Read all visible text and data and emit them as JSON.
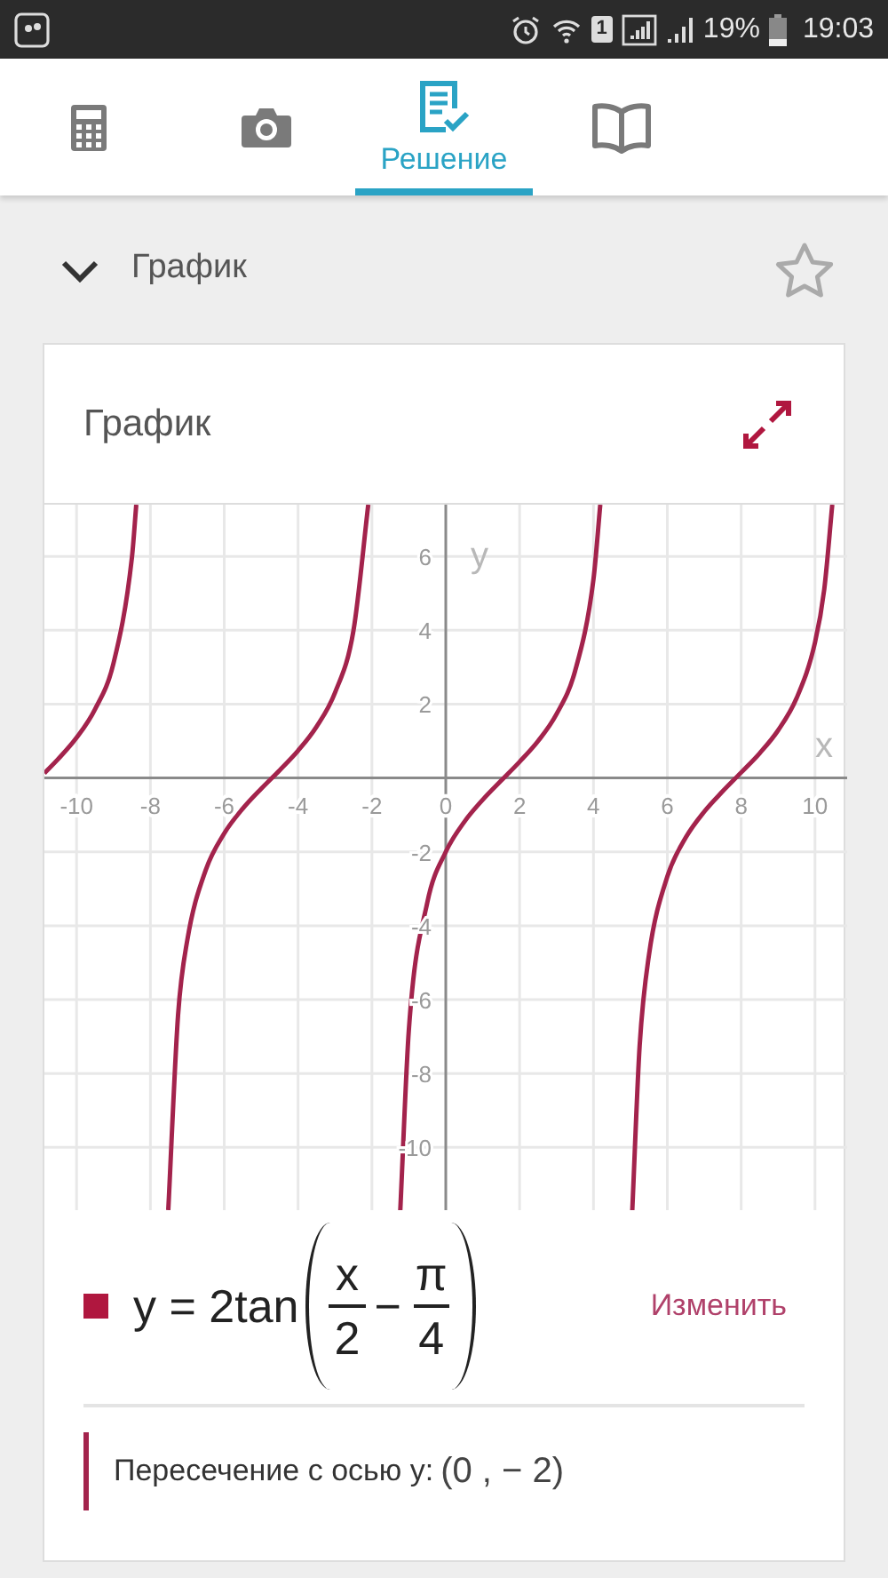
{
  "status_bar": {
    "sim_slot": "1",
    "battery_text": "19%",
    "time": "19:03"
  },
  "tabs": [
    {
      "kind": "calculator",
      "selected": false
    },
    {
      "kind": "camera",
      "selected": false
    },
    {
      "kind": "solution",
      "label": "Решение",
      "selected": true
    },
    {
      "kind": "book",
      "selected": false
    }
  ],
  "section": {
    "title": "График",
    "expanded": true,
    "starred": false
  },
  "card": {
    "title": "График",
    "chart_data": {
      "type": "line",
      "xlabel": "x",
      "ylabel": "y",
      "xlim": [
        -10.87,
        10.87
      ],
      "ylim": [
        -11.7,
        7.4
      ],
      "xticks": [
        -10,
        -8,
        -6,
        -4,
        -2,
        0,
        2,
        4,
        6,
        8,
        10
      ],
      "grid": true,
      "yticks": [
        6,
        4,
        2,
        -2,
        -4,
        -6,
        -8,
        -10
      ],
      "x": [
        -10.87,
        -10.5,
        -10,
        -9.5,
        -9,
        -8.5,
        -8.382,
        -7.515,
        -7.25,
        -7,
        -6.5,
        -6,
        -5.5,
        -5,
        -4.5,
        -4,
        -3.5,
        -3,
        -2.5,
        -2.099,
        -1.232,
        -1,
        -0.5,
        0,
        0.5,
        1,
        1.5,
        2,
        2.5,
        3,
        3.5,
        4,
        4.184,
        5.051,
        5.25,
        5.5,
        6,
        6.5,
        7,
        7.5,
        8,
        8.5,
        9,
        9.5,
        10,
        10.25,
        10.467
      ],
      "series": [
        {
          "color": "#a3234c",
          "values": [
            0.13,
            0.51,
            1.09,
            1.86,
            3.1,
            5.97,
            7.4,
            null,
            null,
            null,
            null,
            null,
            null,
            null,
            null,
            null,
            null,
            null,
            null,
            null,
            null,
            null,
            null,
            null,
            null,
            null,
            null,
            null,
            null,
            null,
            null,
            null,
            null,
            null,
            null,
            null,
            null,
            null,
            null,
            null,
            null,
            null,
            null,
            null,
            null,
            null,
            null
          ]
        },
        {
          "color": "#a3234c",
          "values": [
            null,
            null,
            null,
            null,
            null,
            null,
            null,
            -11.7,
            -6.42,
            -4.39,
            -2.49,
            -1.5,
            -0.83,
            -0.29,
            0.21,
            0.74,
            1.39,
            2.31,
            3.99,
            7.4,
            null,
            null,
            null,
            null,
            null,
            null,
            null,
            null,
            null,
            null,
            null,
            null,
            null,
            null,
            null,
            null,
            null,
            null,
            null,
            null,
            null,
            null,
            null,
            null,
            null,
            null,
            null
          ]
        },
        {
          "color": "#a3234c",
          "values": [
            null,
            null,
            null,
            null,
            null,
            null,
            null,
            null,
            null,
            null,
            null,
            null,
            null,
            null,
            null,
            null,
            null,
            null,
            null,
            null,
            -11.7,
            -6.82,
            -3.37,
            -2,
            -1.19,
            -0.59,
            -0.07,
            0.44,
            1.0,
            1.73,
            2.89,
            5.38,
            7.4,
            null,
            null,
            null,
            null,
            null,
            null,
            null,
            null,
            null,
            null,
            null,
            null,
            null,
            null
          ]
        },
        {
          "color": "#a3234c",
          "values": [
            null,
            null,
            null,
            null,
            null,
            null,
            null,
            null,
            null,
            null,
            null,
            null,
            null,
            null,
            null,
            null,
            null,
            null,
            null,
            null,
            null,
            null,
            null,
            null,
            null,
            null,
            null,
            null,
            null,
            null,
            null,
            null,
            null,
            -11.7,
            -7.26,
            -4.81,
            -2.67,
            -1.61,
            -0.91,
            -0.36,
            0.15,
            0.67,
            1.29,
            2.16,
            3.67,
            5.11,
            7.4
          ]
        }
      ]
    },
    "formula": {
      "color": "#b0173f",
      "prefix": "y = 2tan",
      "numerator_1": "x",
      "denominator_1": "2",
      "operator": "−",
      "numerator_2": "π",
      "denominator_2": "4"
    },
    "edit_link": "Изменить",
    "intersection": {
      "label": "Пересечение с осью y:",
      "value": "(0 , − 2)"
    }
  }
}
